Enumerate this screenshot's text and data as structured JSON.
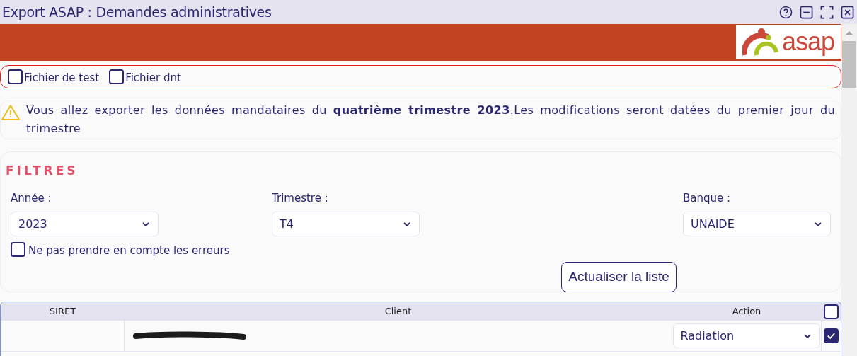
{
  "window": {
    "title": "Export ASAP : Demandes administratives"
  },
  "logo": {
    "text": "asap"
  },
  "options": [
    {
      "label": "Fichier de test",
      "checked": false
    },
    {
      "label": "Fichier dnt",
      "checked": false
    }
  ],
  "warning": "Vous allez exporter les données mandataires du **quatrième trimestre 2023**.Les modifications seront datées du premier jour du trimestre",
  "filters": {
    "title": "FILTRES",
    "selects": [
      {
        "label": "Année :",
        "value": "2023"
      },
      {
        "label": "Trimestre :",
        "value": "T4"
      },
      {
        "label": "Banque :",
        "value": "UNAIDE"
      }
    ],
    "ignore_errors": {
      "label": "Ne pas prendre en compte les erreurs",
      "checked": false
    },
    "button": "Actualiser la liste"
  },
  "table": {
    "columns": [
      "SIRET",
      "Client",
      "Action"
    ],
    "select_all": false,
    "rows": [
      {
        "client_redacted": true,
        "action": "Radiation",
        "checked": true
      }
    ]
  }
}
